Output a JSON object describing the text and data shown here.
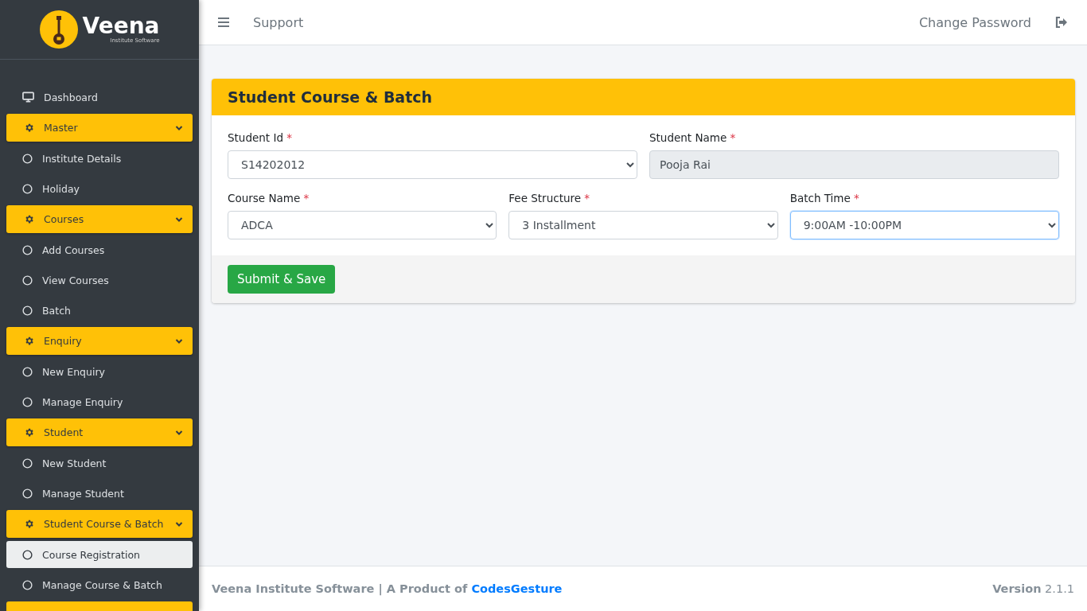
{
  "brand": {
    "name": "Veena",
    "tagline": "Institute Software"
  },
  "sidebar": {
    "items": [
      {
        "kind": "link",
        "label": "Dashboard",
        "selected": false
      },
      {
        "kind": "group",
        "label": "Master",
        "expanded": true
      },
      {
        "kind": "sub",
        "label": "Institute Details",
        "selected": false
      },
      {
        "kind": "sub",
        "label": "Holiday",
        "selected": false
      },
      {
        "kind": "group",
        "label": "Courses",
        "expanded": true
      },
      {
        "kind": "sub",
        "label": "Add Courses",
        "selected": false
      },
      {
        "kind": "sub",
        "label": "View Courses",
        "selected": false
      },
      {
        "kind": "sub",
        "label": "Batch",
        "selected": false
      },
      {
        "kind": "group",
        "label": "Enquiry",
        "expanded": true
      },
      {
        "kind": "sub",
        "label": "New Enquiry",
        "selected": false
      },
      {
        "kind": "sub",
        "label": "Manage Enquiry",
        "selected": false
      },
      {
        "kind": "group",
        "label": "Student",
        "expanded": true
      },
      {
        "kind": "sub",
        "label": "New Student",
        "selected": false
      },
      {
        "kind": "sub",
        "label": "Manage Student",
        "selected": false
      },
      {
        "kind": "group",
        "label": "Student Course & Batch",
        "expanded": true
      },
      {
        "kind": "sub",
        "label": "Course Registration",
        "selected": true
      },
      {
        "kind": "sub",
        "label": "Manage Course & Batch",
        "selected": false
      }
    ]
  },
  "topbar": {
    "links": [
      "Support"
    ],
    "right_link": "Change Password"
  },
  "card": {
    "title": "Student Course & Batch",
    "rows": [
      [
        {
          "kind": "select",
          "label": "Student Id",
          "required_mark": "*",
          "value": "S14202012",
          "focused": false
        },
        {
          "kind": "readonly",
          "label": "Student Name",
          "required_mark": "*",
          "value": "Pooja Rai",
          "focused": false
        }
      ],
      [
        {
          "kind": "select",
          "label": "Course Name",
          "required_mark": "*",
          "value": "ADCA",
          "focused": false
        },
        {
          "kind": "select",
          "label": "Fee Structure",
          "required_mark": "*",
          "value": "3 Installment",
          "focused": false
        },
        {
          "kind": "select",
          "label": "Batch Time",
          "required_mark": "*",
          "value": "9:00AM -10:00PM",
          "focused": true
        }
      ]
    ],
    "submit": "Submit & Save"
  },
  "footer": {
    "text": "Veena Institute Software | A Product of ",
    "link": "CodesGesture",
    "version": "**Version** 2.1.1"
  }
}
